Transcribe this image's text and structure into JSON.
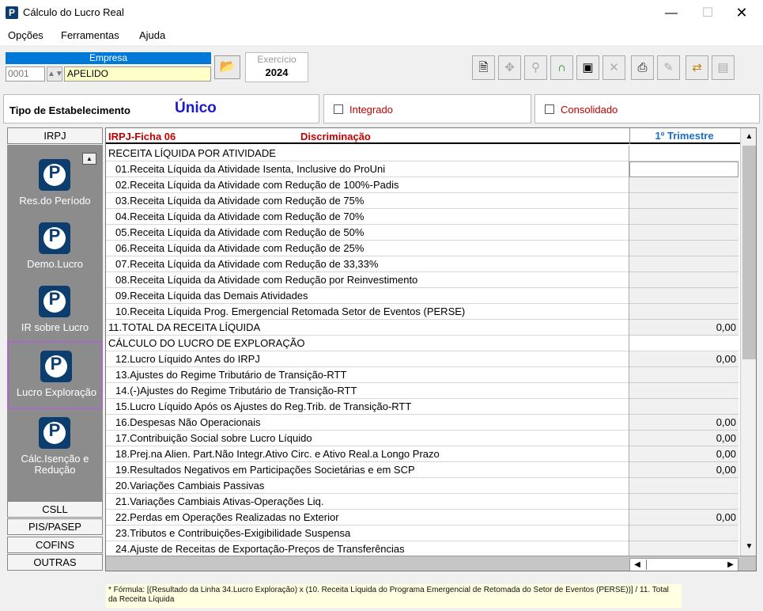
{
  "window": {
    "title": "Cálculo do Lucro Real",
    "minimize": "—",
    "maximize": "☐",
    "close": "✕"
  },
  "menu": [
    "Opções",
    "Ferramentas",
    "Ajuda"
  ],
  "empresa": {
    "label": "Empresa",
    "code": "0001",
    "name": "APELIDO"
  },
  "exercicio": {
    "label": "Exercício",
    "value": "2024"
  },
  "toolbar_icons": [
    "document-icon",
    "target-icon",
    "search-person-icon",
    "lock-icon",
    "save-icon",
    "delete-icon",
    "print-icon",
    "edit-icon",
    "import-icon",
    "export-icon"
  ],
  "tipo": {
    "label": "Tipo de Estabelecimento",
    "value": "Único",
    "integrado": "Integrado",
    "consolidado": "Consolidado"
  },
  "sidebar": {
    "tab_irpj": "IRPJ",
    "items": [
      "Res.do Período",
      "Demo.Lucro",
      "IR sobre Lucro",
      "Lucro Exploração",
      "Cálc.Isenção e Redução"
    ],
    "active_index": 3,
    "tabs_bottom": [
      "CSLL",
      "PIS/PASEP",
      "COFINS",
      "OUTRAS"
    ]
  },
  "grid": {
    "ficha": "IRPJ-Ficha 06",
    "col_desc": "Discriminação",
    "col_value": "1º Trimestre",
    "rows": [
      {
        "d": "RECEITA LÍQUIDA POR ATIVIDADE",
        "v": "",
        "indent": false,
        "type": "section"
      },
      {
        "d": "01.Receita Líquida da Atividade Isenta, Inclusive do ProUni",
        "v": "",
        "indent": true,
        "type": "input"
      },
      {
        "d": "02.Receita Líquida da Atividade com Redução de 100%-Padis",
        "v": "",
        "indent": true,
        "type": "calc"
      },
      {
        "d": "03.Receita Líquida da Atividade com Redução de 75%",
        "v": "",
        "indent": true,
        "type": "calc"
      },
      {
        "d": "04.Receita Líquida da Atividade com Redução de 70%",
        "v": "",
        "indent": true,
        "type": "calc"
      },
      {
        "d": "05.Receita Líquida da Atividade com Redução de 50%",
        "v": "",
        "indent": true,
        "type": "calc"
      },
      {
        "d": "06.Receita Líquida da Atividade com Redução de 25%",
        "v": "",
        "indent": true,
        "type": "calc"
      },
      {
        "d": "07.Receita Líquida da Atividade com Redução de 33,33%",
        "v": "",
        "indent": true,
        "type": "calc"
      },
      {
        "d": "08.Receita Líquida da Atividade com Redução por Reinvestimento",
        "v": "",
        "indent": true,
        "type": "calc"
      },
      {
        "d": "09.Receita Líquida das Demais Atividades",
        "v": "",
        "indent": true,
        "type": "calc"
      },
      {
        "d": "10.Receita Líquida Prog. Emergencial Retomada Setor de Eventos (PERSE)",
        "v": "",
        "indent": true,
        "type": "calc"
      },
      {
        "d": "11.TOTAL DA RECEITA LÍQUIDA",
        "v": "0,00",
        "indent": false,
        "type": "calc"
      },
      {
        "d": "CÁLCULO DO LUCRO DE EXPLORAÇÃO",
        "v": "",
        "indent": false,
        "type": "section"
      },
      {
        "d": "12.Lucro Líquido Antes do IRPJ",
        "v": "0,00",
        "indent": true,
        "type": "calc"
      },
      {
        "d": "13.Ajustes do Regime Tributário de Transição-RTT",
        "v": "",
        "indent": true,
        "type": "calc"
      },
      {
        "d": "14.(-)Ajustes do Regime Tributário de Transição-RTT",
        "v": "",
        "indent": true,
        "type": "calc"
      },
      {
        "d": "15.Lucro Líquido Após os Ajustes do Reg.Trib. de Transição-RTT",
        "v": "",
        "indent": true,
        "type": "calc"
      },
      {
        "d": "16.Despesas Não Operacionais",
        "v": "0,00",
        "indent": true,
        "type": "calc"
      },
      {
        "d": "17.Contribuição Social sobre Lucro Líquido",
        "v": "0,00",
        "indent": true,
        "type": "calc"
      },
      {
        "d": "18.Prej.na Alien. Part.Não Integr.Ativo Circ. e Ativo Real.a Longo Prazo",
        "v": "0,00",
        "indent": true,
        "type": "calc"
      },
      {
        "d": "19.Resultados Negativos em Participações Societárias e em SCP",
        "v": "0,00",
        "indent": true,
        "type": "calc"
      },
      {
        "d": "20.Variações Cambiais Passivas",
        "v": "",
        "indent": true,
        "type": "calc"
      },
      {
        "d": "21.Variações Cambiais Ativas-Operações Liq.",
        "v": "",
        "indent": true,
        "type": "calc"
      },
      {
        "d": "22.Perdas em Operações Realizadas no Exterior",
        "v": "0,00",
        "indent": true,
        "type": "calc"
      },
      {
        "d": "23.Tributos e Contribuições-Exigibilidade Suspensa",
        "v": "",
        "indent": true,
        "type": "calc"
      },
      {
        "d": "24.Ajuste de Receitas de Exportação-Preços de Transferências",
        "v": "",
        "indent": true,
        "type": "calc"
      }
    ]
  },
  "formula": "* Fórmula: [(Resultado da Linha 34.Lucro Exploração) x (10. Receita Líquida do Programa Emergencial de Retomada do Setor de Eventos (PERSE))] / 11. Total da Receita Líquida"
}
